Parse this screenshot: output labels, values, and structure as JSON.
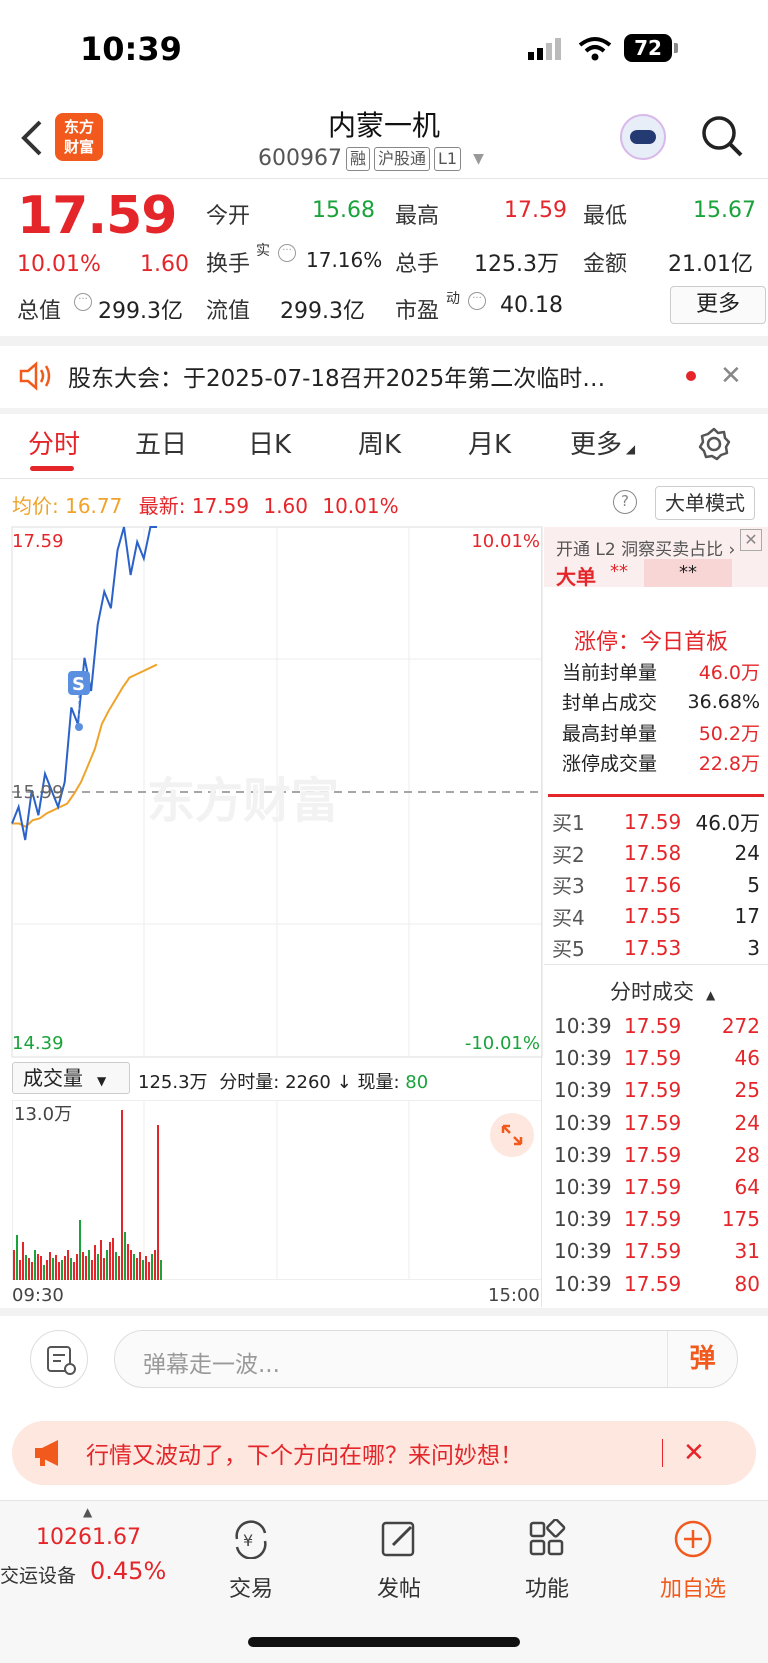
{
  "status": {
    "time": "10:39",
    "battery": "72"
  },
  "header": {
    "logo_line1": "东方",
    "logo_line2": "财富",
    "title": "内蒙一机",
    "code": "600967",
    "tags": [
      "融",
      "沪股通",
      "L1"
    ]
  },
  "quote": {
    "price": "17.59",
    "pct": "10.01%",
    "change": "1.60",
    "open_label": "今开",
    "open": "15.68",
    "high_label": "最高",
    "high": "17.59",
    "low_label": "最低",
    "low": "15.67",
    "turnover_label": "换手",
    "turnover_sup": "实",
    "turnover": "17.16%",
    "volume_label": "总手",
    "volume": "125.3万",
    "amount_label": "金额",
    "amount": "21.01亿",
    "mcap_label": "总值",
    "mcap": "299.3亿",
    "float_label": "流值",
    "float": "299.3亿",
    "pe_label": "市盈",
    "pe_sup": "动",
    "pe": "40.18",
    "more": "更多"
  },
  "notice": {
    "text": "股东大会：于2025-07-18召开2025年第二次临时…"
  },
  "tabs": [
    "分时",
    "五日",
    "日K",
    "周K",
    "月K",
    "更多"
  ],
  "info": {
    "avg_label": "均价:",
    "avg": "16.77",
    "latest_label": "最新:",
    "latest": "17.59",
    "change": "1.60",
    "pct": "10.01%",
    "mode": "大单模式"
  },
  "chart": {
    "top_price": "17.59",
    "mid_price": "15.99",
    "bottom_price": "14.39",
    "top_pct": "10.01%",
    "bottom_pct": "-10.01%",
    "watermark": "东方财富",
    "marker": "S",
    "vol_selector": "成交量",
    "vol_total": "125.3万",
    "vol_minute_label": "分时量:",
    "vol_minute": "2260",
    "vol_now_label": "现量:",
    "vol_now": "80",
    "vol_max": "13.0万",
    "time_start": "09:30",
    "time_end": "15:00"
  },
  "chart_data": {
    "type": "line",
    "x_range": [
      "09:30",
      "15:00"
    ],
    "ylim": [
      14.39,
      17.59
    ],
    "reference": 15.99,
    "series": [
      {
        "values": [
          15.8,
          15.9,
          15.7,
          16.0,
          15.85,
          16.1,
          16.0,
          15.9,
          16.05,
          16.5,
          16.4,
          16.8,
          16.6,
          17.0,
          17.2,
          17.1,
          17.45,
          17.59,
          17.3,
          17.5,
          17.4,
          17.59,
          17.59
        ]
      },
      {
        "values": [
          15.8,
          15.8,
          15.78,
          15.82,
          15.83,
          15.86,
          15.88,
          15.9,
          15.92,
          15.98,
          16.05,
          16.15,
          16.25,
          16.4,
          16.48,
          16.55,
          16.62,
          16.68,
          16.7,
          16.72,
          16.74,
          16.76,
          16.77
        ]
      }
    ]
  },
  "side": {
    "l2": "开通 L2 洞察买卖占比",
    "big_label": "大单",
    "stars": "**",
    "limit_title": "涨停：今日首板",
    "limit": [
      [
        "当前封单量",
        "46.0万"
      ],
      [
        "封单占成交",
        "36.68%"
      ],
      [
        "最高封单量",
        "50.2万"
      ],
      [
        "涨停成交量",
        "22.8万"
      ]
    ],
    "bids": [
      [
        "买1",
        "17.59",
        "46.0万"
      ],
      [
        "买2",
        "17.58",
        "24"
      ],
      [
        "买3",
        "17.56",
        "5"
      ],
      [
        "买4",
        "17.55",
        "17"
      ],
      [
        "买5",
        "17.53",
        "3"
      ]
    ],
    "trades_title": "分时成交",
    "trades": [
      [
        "10:39",
        "17.59",
        "272"
      ],
      [
        "10:39",
        "17.59",
        "46"
      ],
      [
        "10:39",
        "17.59",
        "25"
      ],
      [
        "10:39",
        "17.59",
        "24"
      ],
      [
        "10:39",
        "17.59",
        "28"
      ],
      [
        "10:39",
        "17.59",
        "64"
      ],
      [
        "10:39",
        "17.59",
        "175"
      ],
      [
        "10:39",
        "17.59",
        "31"
      ],
      [
        "10:39",
        "17.59",
        "80"
      ]
    ]
  },
  "comment": {
    "placeholder": "弹幕走一波...",
    "send": "弹"
  },
  "banner": {
    "text": "行情又波动了，下个方向在哪？来问妙想！"
  },
  "nav": {
    "index_value": "10261.67",
    "index_name": "交运设备",
    "index_pct": "0.45%",
    "items": [
      "交易",
      "发帖",
      "功能",
      "加自选"
    ]
  },
  "colors": {
    "red": "#e4262a",
    "green": "#1aa33b",
    "accent": "#f25a1d"
  }
}
